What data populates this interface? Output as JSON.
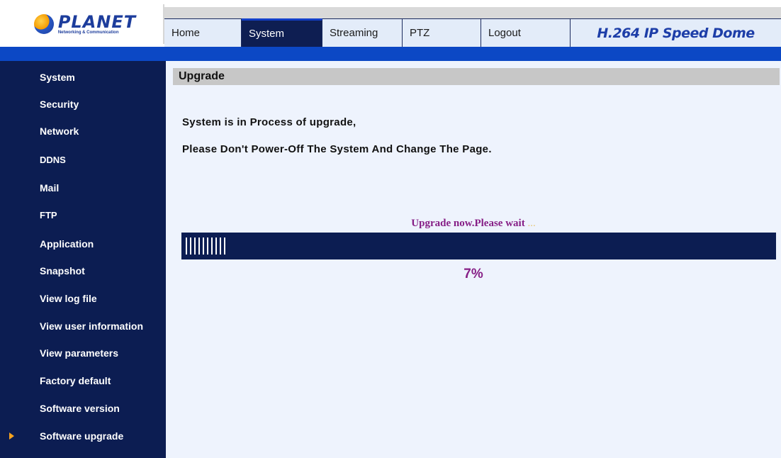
{
  "header": {
    "logo_text": "PLANET",
    "logo_subtext": "Networking & Communication",
    "product_title": "H.264 IP Speed Dome",
    "tabs": [
      {
        "label": "Home",
        "active": false
      },
      {
        "label": "System",
        "active": true
      },
      {
        "label": "Streaming",
        "active": false
      },
      {
        "label": "PTZ",
        "active": false
      },
      {
        "label": "Logout",
        "active": false
      }
    ]
  },
  "sidebar": {
    "items": [
      {
        "label": "System"
      },
      {
        "label": "Security"
      },
      {
        "label": "Network"
      },
      {
        "label": "DDNS"
      },
      {
        "label": "Mail"
      },
      {
        "label": "FTP"
      },
      {
        "label": "Application"
      },
      {
        "label": "Snapshot"
      },
      {
        "label": "View log file"
      },
      {
        "label": "View user information"
      },
      {
        "label": "View parameters"
      },
      {
        "label": "Factory default"
      },
      {
        "label": "Software version"
      },
      {
        "label": "Software upgrade",
        "selected": true
      }
    ]
  },
  "main": {
    "section_title": "Upgrade",
    "message_line1": "System is in Process of upgrade,",
    "message_line2": "Please Don't Power-Off The System And Change The Page.",
    "wait_text": "Upgrade now.Please wait",
    "wait_dots": "...",
    "progress": {
      "percent": 7,
      "percent_label": "7%"
    }
  },
  "colors": {
    "navy": "#0c1d52",
    "accent_blue": "#0c48c5",
    "progress_text": "#861f86",
    "selected_arrow": "#f6a31f"
  }
}
